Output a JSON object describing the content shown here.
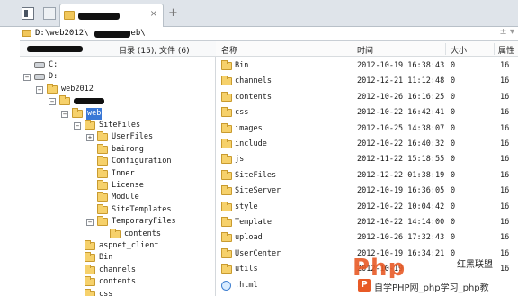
{
  "tab": {
    "new_tab_symbol": "+"
  },
  "address": {
    "path_prefix": "D:\\web2012\\",
    "path_suffix": "web\\",
    "dropdown_symbols": "± ▾"
  },
  "left_panel": {
    "counts": "目录 (15), 文件 (6)"
  },
  "tree": [
    {
      "label": "C:",
      "type": "drive"
    },
    {
      "label": "D:",
      "type": "drive"
    },
    {
      "label": "web2012",
      "type": "folder"
    },
    {
      "label": "",
      "type": "folder",
      "redacted": true
    },
    {
      "label": "web",
      "type": "folder",
      "selected": true
    },
    {
      "label": "SiteFiles",
      "type": "folder"
    },
    {
      "label": "UserFiles",
      "type": "folder"
    },
    {
      "label": "bairong",
      "type": "folder"
    },
    {
      "label": "Configuration",
      "type": "folder"
    },
    {
      "label": "Inner",
      "type": "folder"
    },
    {
      "label": "License",
      "type": "folder"
    },
    {
      "label": "Module",
      "type": "folder"
    },
    {
      "label": "SiteTemplates",
      "type": "folder"
    },
    {
      "label": "TemporaryFiles",
      "type": "folder"
    },
    {
      "label": "contents",
      "type": "folder"
    },
    {
      "label": "aspnet_client",
      "type": "folder"
    },
    {
      "label": "Bin",
      "type": "folder"
    },
    {
      "label": "channels",
      "type": "folder"
    },
    {
      "label": "contents",
      "type": "folder"
    },
    {
      "label": "css",
      "type": "folder"
    }
  ],
  "columns": {
    "name": "名称",
    "time": "时间",
    "size": "大小",
    "attr": "属性"
  },
  "files": [
    {
      "name": "Bin",
      "time": "2012-10-19 16:38:43",
      "size": "0",
      "attr": "16"
    },
    {
      "name": "channels",
      "time": "2012-12-21 11:12:48",
      "size": "0",
      "attr": "16"
    },
    {
      "name": "contents",
      "time": "2012-10-26 16:16:25",
      "size": "0",
      "attr": "16"
    },
    {
      "name": "css",
      "time": "2012-10-22 16:42:41",
      "size": "0",
      "attr": "16"
    },
    {
      "name": "images",
      "time": "2012-10-25 14:38:07",
      "size": "0",
      "attr": "16"
    },
    {
      "name": "include",
      "time": "2012-10-22 16:40:32",
      "size": "0",
      "attr": "16"
    },
    {
      "name": "js",
      "time": "2012-11-22 15:18:55",
      "size": "0",
      "attr": "16"
    },
    {
      "name": "SiteFiles",
      "time": "2012-12-22 01:38:19",
      "size": "0",
      "attr": "16"
    },
    {
      "name": "SiteServer",
      "time": "2012-10-19 16:36:05",
      "size": "0",
      "attr": "16"
    },
    {
      "name": "style",
      "time": "2012-10-22 10:04:42",
      "size": "0",
      "attr": "16"
    },
    {
      "name": "Template",
      "time": "2012-10-22 14:14:00",
      "size": "0",
      "attr": "16"
    },
    {
      "name": "upload",
      "time": "2012-10-26 17:32:43",
      "size": "0",
      "attr": "16"
    },
    {
      "name": "UserCenter",
      "time": "2012-10-19 16:34:21",
      "size": "0",
      "attr": "16"
    },
    {
      "name": "utils",
      "time": "2012-10-19",
      "size": "",
      "attr": "16"
    },
    {
      "name": ".html",
      "time": "20",
      "size": "",
      "attr": ""
    }
  ],
  "watermark": {
    "logo": "Php",
    "cn_right": "红黑联盟",
    "badge": "P",
    "text": "自学PHP网_php学习_php教"
  }
}
